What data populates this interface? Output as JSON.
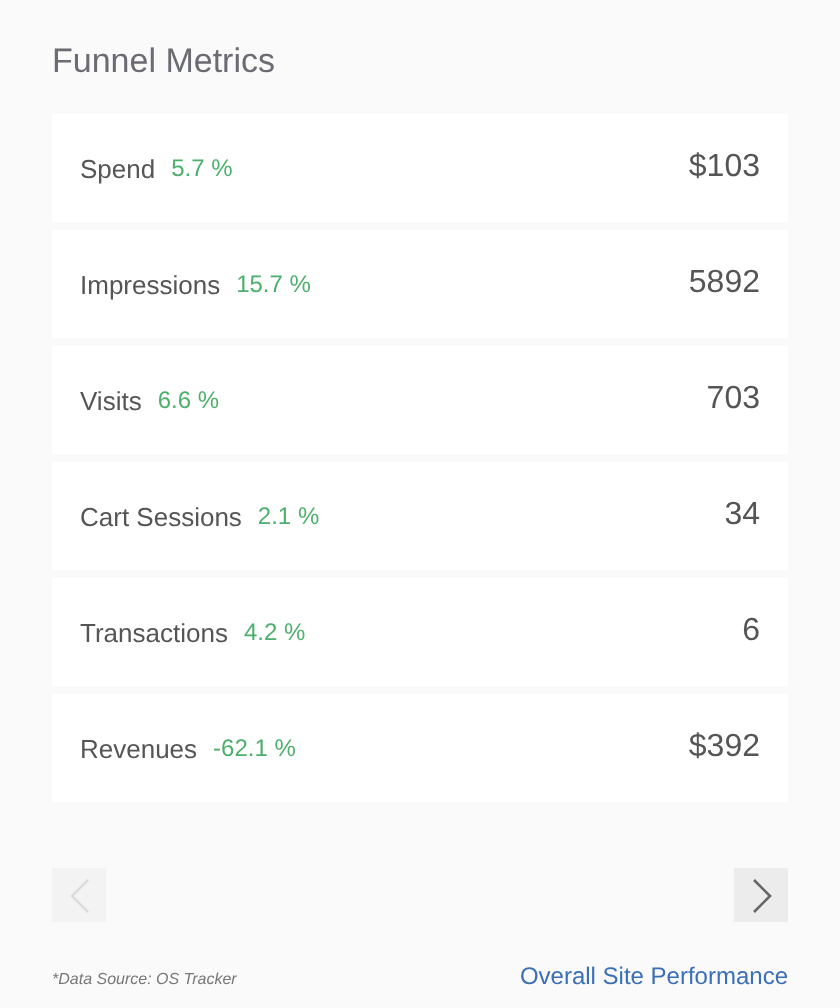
{
  "title": "Funnel Metrics",
  "metrics": [
    {
      "label": "Spend",
      "change": "5.7 %",
      "value": "$103"
    },
    {
      "label": "Impressions",
      "change": "15.7 %",
      "value": "5892"
    },
    {
      "label": "Visits",
      "change": "6.6 %",
      "value": "703"
    },
    {
      "label": "Cart Sessions",
      "change": "2.1 %",
      "value": "34"
    },
    {
      "label": "Transactions",
      "change": "4.2 %",
      "value": "6"
    },
    {
      "label": "Revenues",
      "change": "-62.1 %",
      "value": "$392"
    }
  ],
  "pager": {
    "previous_disabled": true,
    "next_disabled": false
  },
  "footer": {
    "source_note": "*Data Source: OS Tracker",
    "link": "Overall Site Performance"
  }
}
